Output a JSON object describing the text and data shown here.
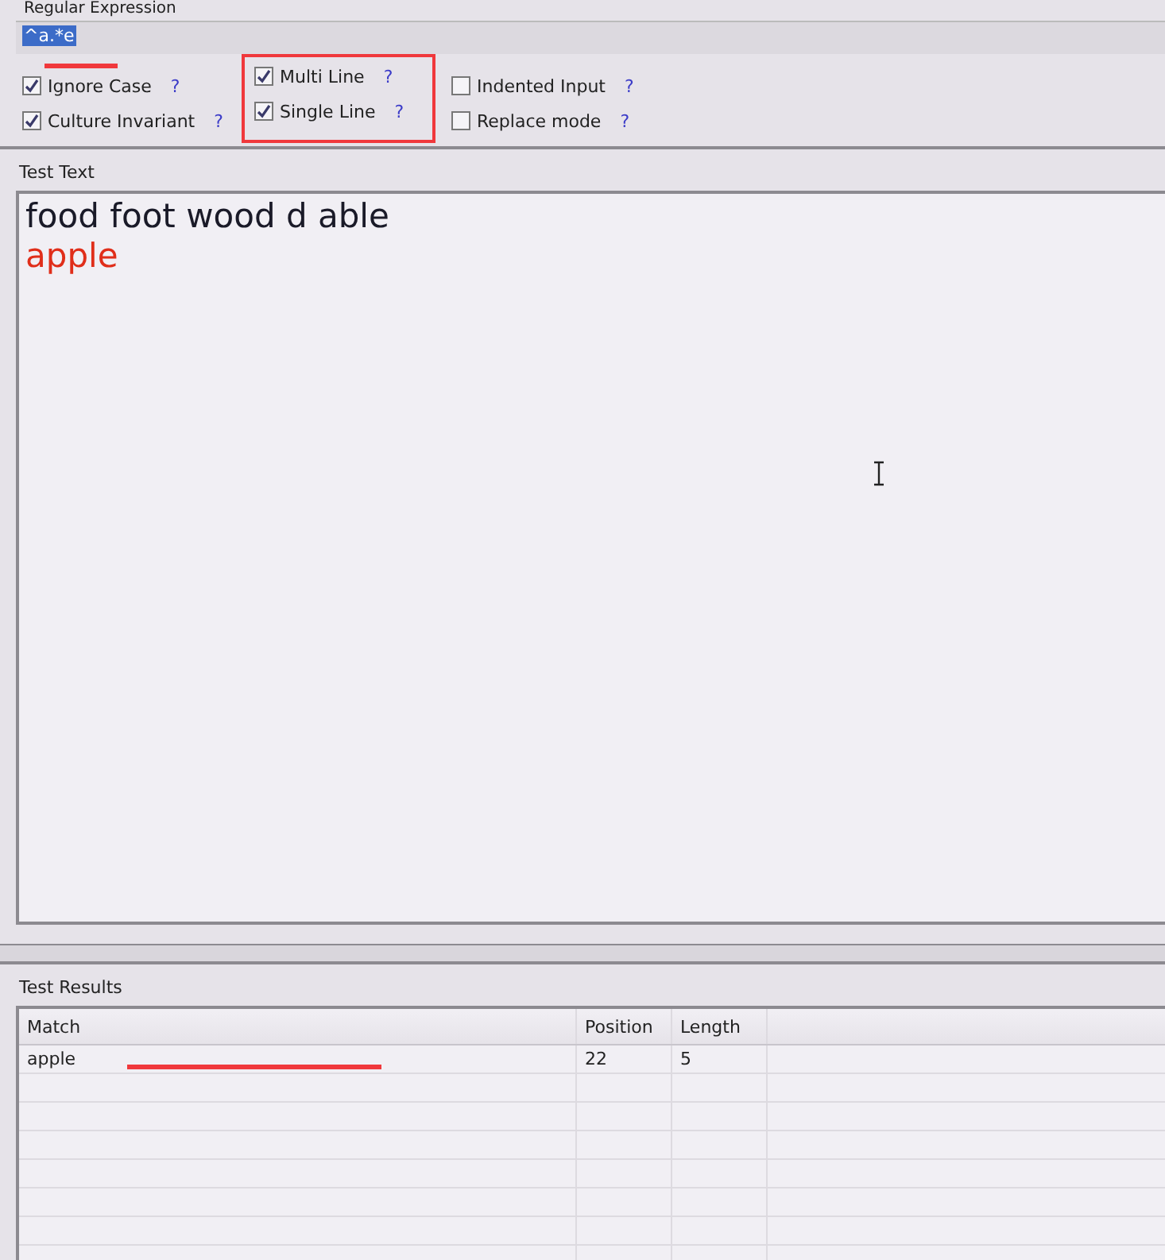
{
  "regex_panel": {
    "title": "Regular Expression",
    "pattern": "^a.*e"
  },
  "option_groups": [
    {
      "options": [
        {
          "label": "Ignore Case",
          "checked": true,
          "help": "?"
        },
        {
          "label": "Culture Invariant",
          "checked": true,
          "help": "?"
        }
      ]
    },
    {
      "options": [
        {
          "label": "Multi Line",
          "checked": true,
          "help": "?"
        },
        {
          "label": "Single Line",
          "checked": true,
          "help": "?"
        }
      ]
    },
    {
      "options": [
        {
          "label": "Indented Input",
          "checked": false,
          "help": "?"
        },
        {
          "label": "Replace mode",
          "checked": false,
          "help": "?"
        }
      ]
    }
  ],
  "test_text": {
    "title": "Test Text",
    "lines": [
      {
        "text": "food foot wood d able",
        "matched": false
      },
      {
        "text": "apple",
        "matched": true
      }
    ]
  },
  "test_results": {
    "title": "Test Results",
    "columns": [
      "Match",
      "Position",
      "Length"
    ],
    "rows": [
      [
        "apple",
        "22",
        "5"
      ]
    ]
  }
}
